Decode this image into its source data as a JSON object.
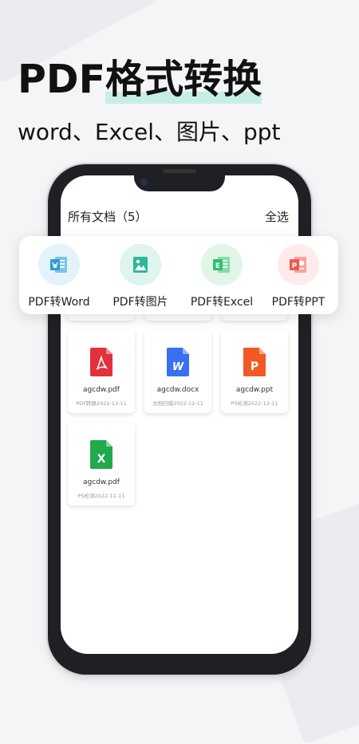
{
  "headline": {
    "pdf": "PDF",
    "highlight": "格式转换",
    "subtitle": "word、Excel、图片、ppt"
  },
  "screen": {
    "title": "所有文档（5）",
    "select_all": "全选"
  },
  "tools": [
    {
      "label": "PDF转Word",
      "icon": "word-doc-icon",
      "bg": "#e4f3fa",
      "color": "#2f9bd3"
    },
    {
      "label": "PDF转图片",
      "icon": "image-icon",
      "bg": "#dff3ef",
      "color": "#2cb89b"
    },
    {
      "label": "PDF转Excel",
      "icon": "excel-doc-icon",
      "bg": "#e1f5e9",
      "color": "#2fbf6d"
    },
    {
      "label": "PDF转PPT",
      "icon": "ppt-doc-icon",
      "bg": "#fdeceb",
      "color": "#ef5a4d"
    }
  ],
  "files": [
    {
      "name": "agcdw.pdf",
      "meta": "PDF转换2022-12-11",
      "icon": "pdf-file-icon",
      "color": "#e3313b",
      "letter": ""
    },
    {
      "name": "agcdw.docx",
      "meta": "文档扫描2022-12-11",
      "icon": "word-file-icon",
      "color": "#3a6ff0",
      "letter": "W"
    },
    {
      "name": "agcdw.ppt",
      "meta": "PS检测2022-12-11",
      "icon": "ppt-file-icon",
      "color": "#f15a24",
      "letter": "P"
    },
    {
      "name": "agcdw.pdf",
      "meta": "PS检测2022-12-11",
      "icon": "excel-file-icon",
      "color": "#1faa4b",
      "letter": "X"
    }
  ]
}
